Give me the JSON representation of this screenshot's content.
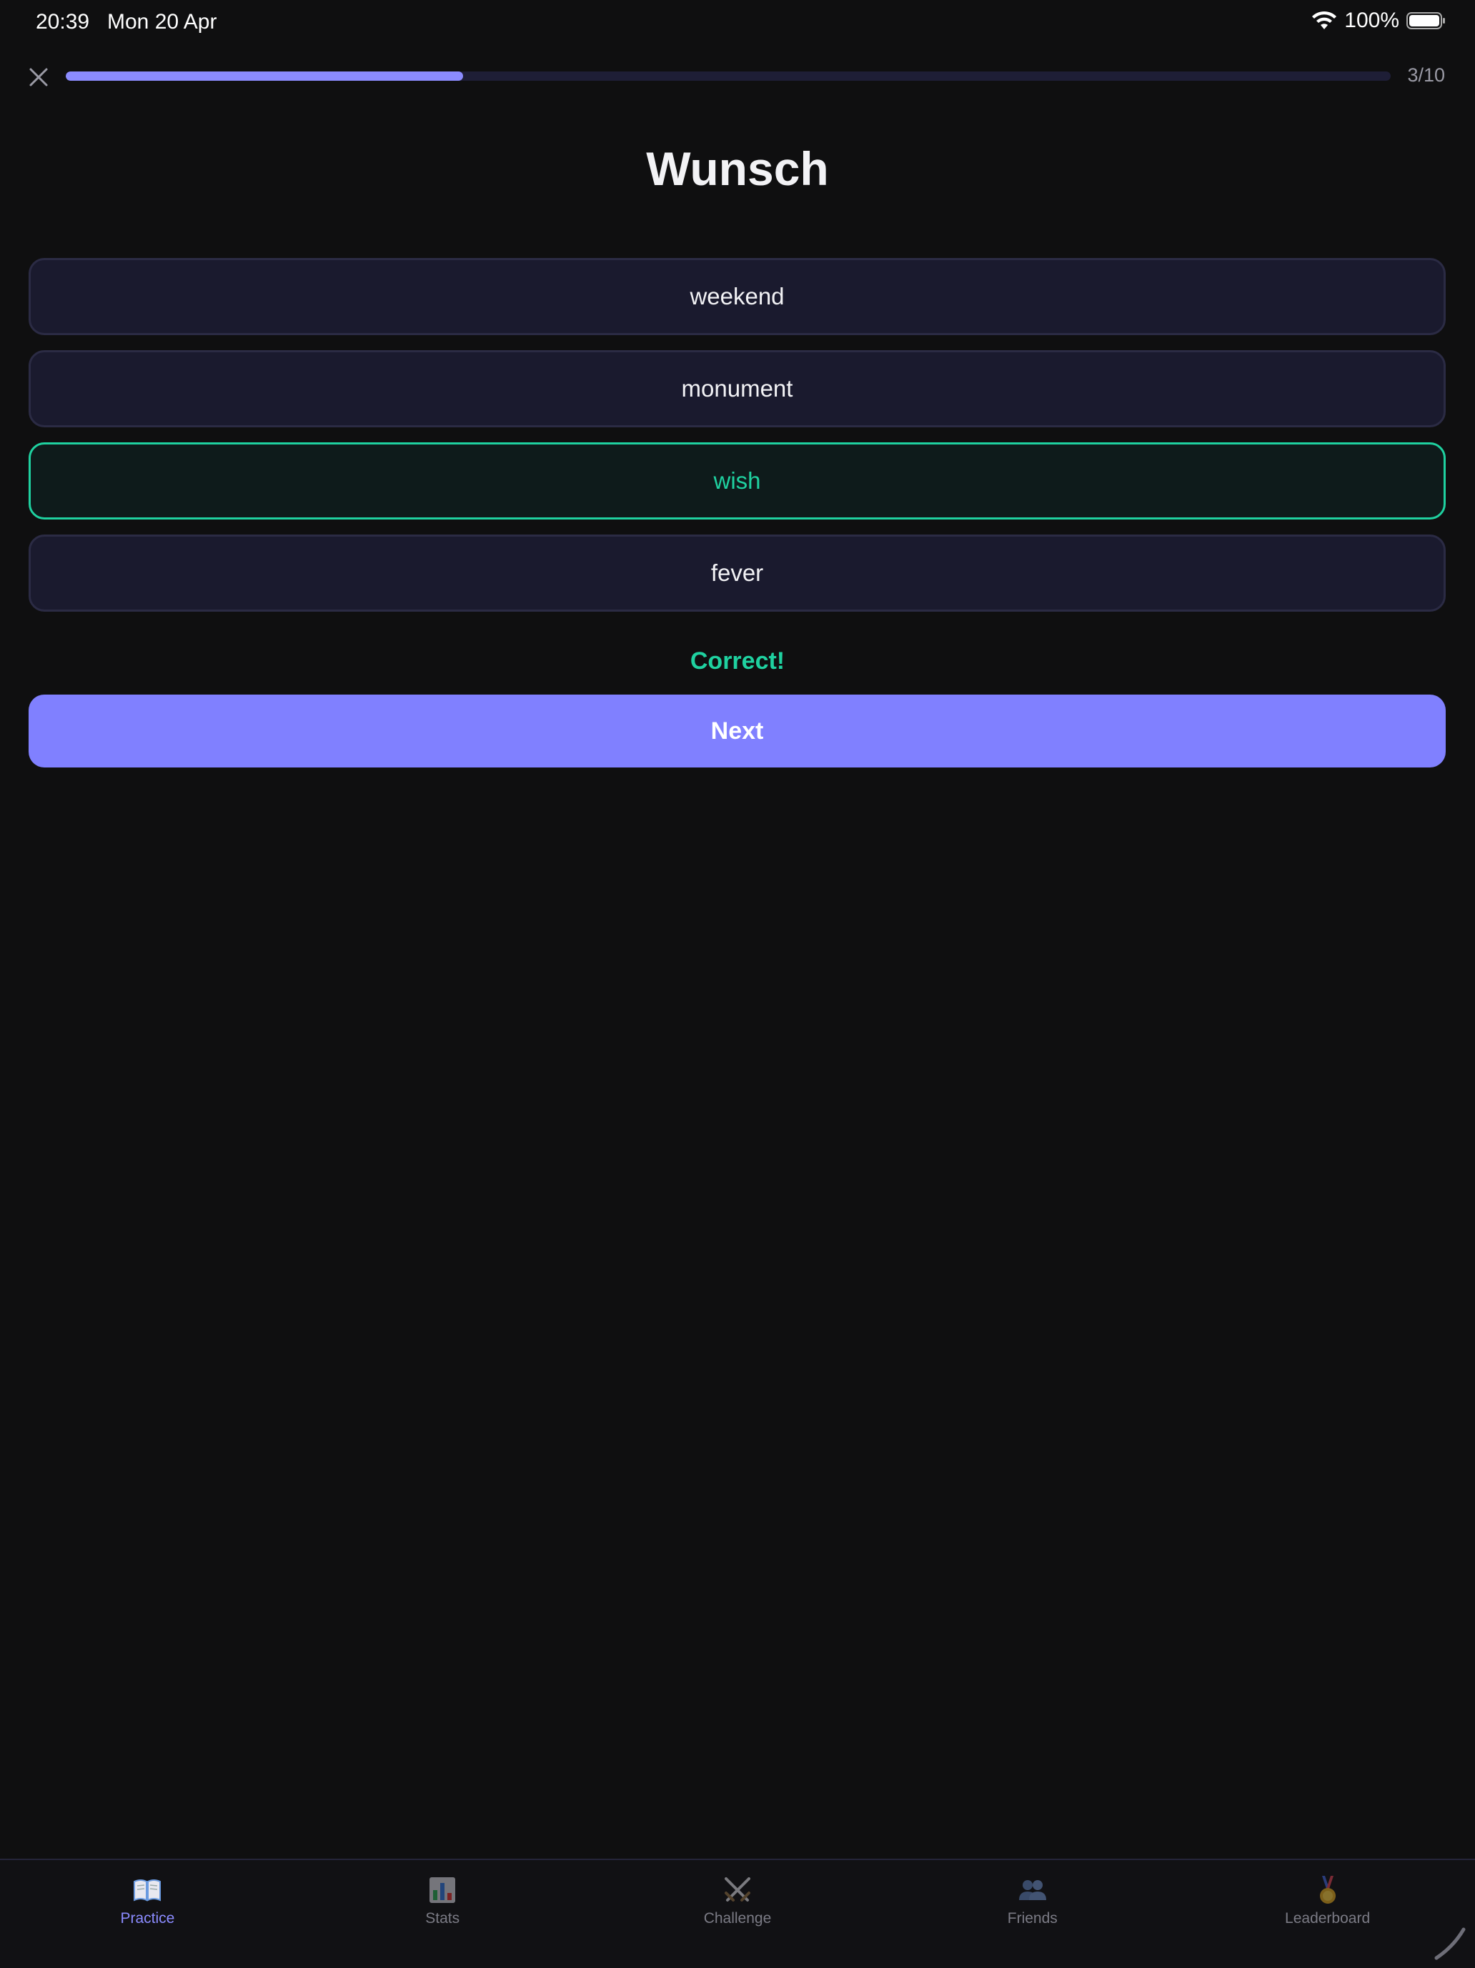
{
  "status_bar": {
    "time": "20:39",
    "date": "Mon 20 Apr",
    "battery": "100%"
  },
  "quiz": {
    "progress_text": "3/10",
    "progress_fraction": 0.3,
    "word": "Wunsch",
    "options": [
      {
        "label": "weekend",
        "state": "default"
      },
      {
        "label": "monument",
        "state": "default"
      },
      {
        "label": "wish",
        "state": "correct"
      },
      {
        "label": "fever",
        "state": "default"
      }
    ],
    "feedback": "Correct!",
    "next_label": "Next"
  },
  "tabs": [
    {
      "label": "Practice",
      "icon": "book-icon",
      "active": true
    },
    {
      "label": "Stats",
      "icon": "bar-chart-icon",
      "active": false
    },
    {
      "label": "Challenge",
      "icon": "crossed-swords-icon",
      "active": false
    },
    {
      "label": "Friends",
      "icon": "people-icon",
      "active": false
    },
    {
      "label": "Leaderboard",
      "icon": "medal-icon",
      "active": false
    }
  ],
  "colors": {
    "background": "#0f0f10",
    "accent": "#8080ff",
    "correct": "#1fd1a0",
    "option_bg": "#1a1a2e",
    "option_border": "#2b2b44"
  }
}
